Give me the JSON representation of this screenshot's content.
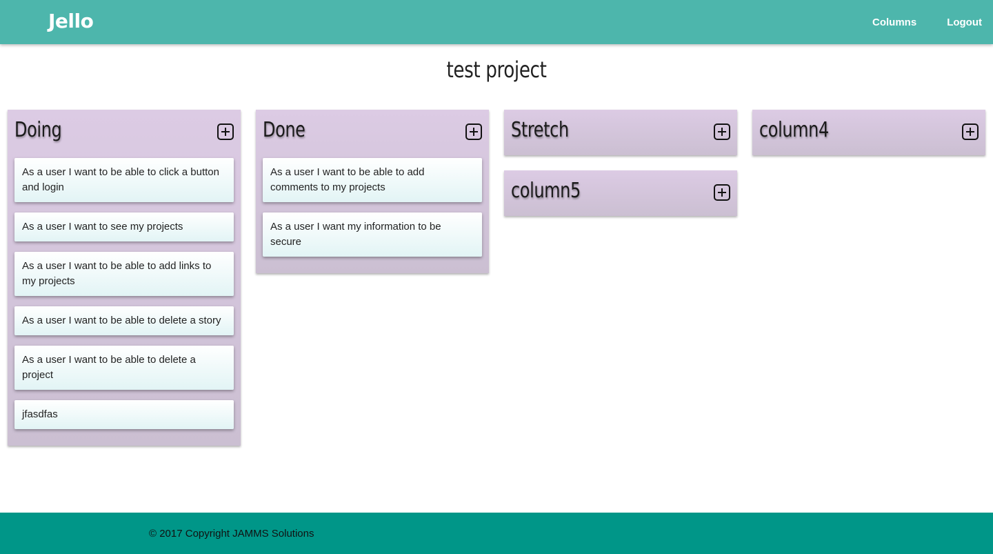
{
  "navbar": {
    "brand": "Jello",
    "links": [
      "Columns",
      "Logout"
    ]
  },
  "project": {
    "title": "test project"
  },
  "columns": [
    {
      "title": "Doing",
      "cards": [
        "As a user I want to be able to click a button and login",
        "As a user I want to see my projects",
        "As a user I want to be able to add links to my projects",
        "As a user I want to be able to delete a story",
        "As a user I want to be able to delete a project",
        "jfasdfas"
      ]
    },
    {
      "title": "Done",
      "cards": [
        "As a user I want to be able to add comments to my projects",
        "As a user I want my information to be secure"
      ]
    },
    {
      "title": "Stretch",
      "cards": []
    },
    {
      "title": "column4",
      "cards": []
    },
    {
      "title": "column5",
      "cards": []
    }
  ],
  "add_icon": "plus-square-icon",
  "colors": {
    "navbar": "#4db6ac",
    "footer": "#009688",
    "column": "#dccbe4",
    "card": "#e2f4f5"
  },
  "footer": {
    "copyright": "© 2017 Copyright JAMMS Solutions"
  }
}
